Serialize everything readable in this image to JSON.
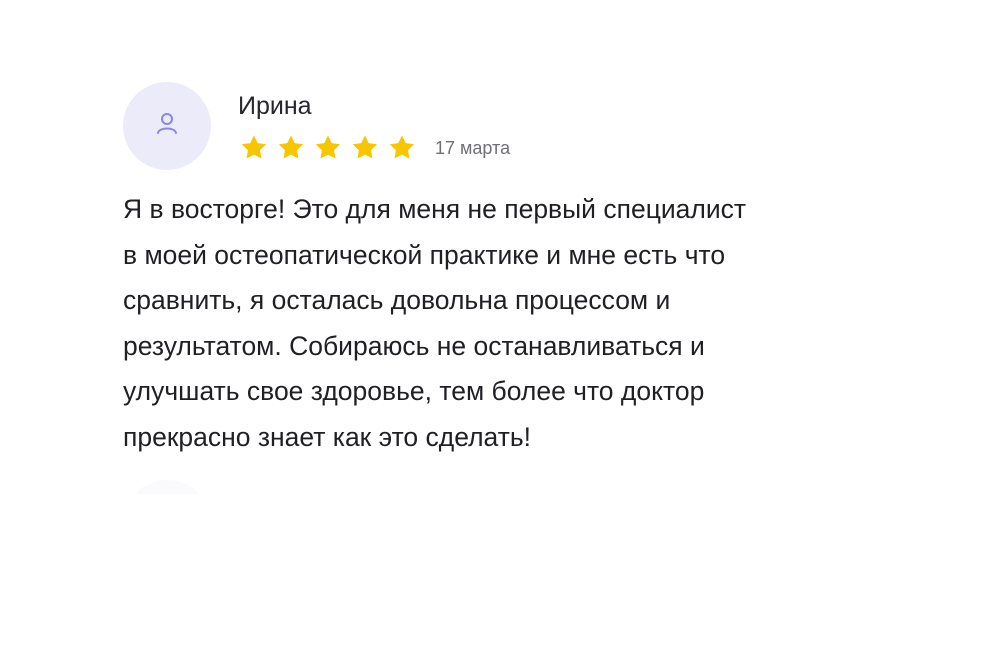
{
  "review": {
    "author": "Ирина",
    "rating": 5,
    "rating_max": 5,
    "date": "17 марта",
    "text_lines": [
      "Я в восторге! Это для меня не первый специалист",
      "в моей остеопатической практике и мне есть что",
      "сравнить, я осталась довольна процессом и",
      "результатом. Собираюсь не останавливаться и",
      "улучшать свое здоровье, тем более что доктор",
      "прекрасно знает как это сделать!"
    ]
  },
  "icons": {
    "avatar": "user-icon",
    "star": "star-icon"
  },
  "colors": {
    "avatar_bg": "#ecebfa",
    "avatar_icon": "#8c84e6",
    "star": "#f7c600",
    "date": "#6f6f78",
    "text": "#1f1f24"
  }
}
